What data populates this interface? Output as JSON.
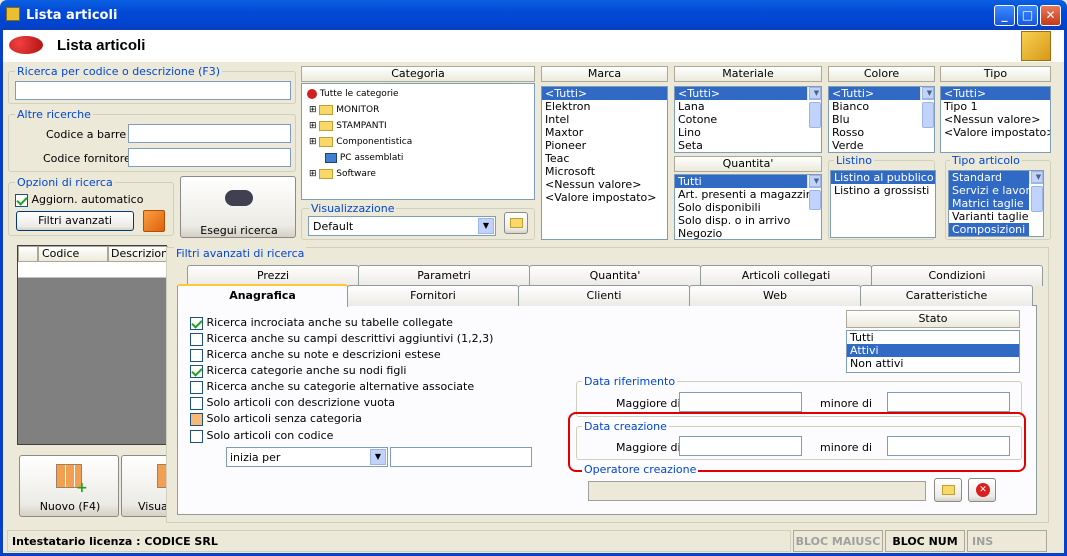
{
  "window": {
    "title": "Lista articoli",
    "header": "Lista articoli",
    "min": "_",
    "max": "□",
    "close": "✕"
  },
  "search": {
    "label": "Ricerca per codice o descrizione (F3)",
    "value": ""
  },
  "other": {
    "label": "Altre ricerche",
    "barcode_label": "Codice a barre :",
    "supplier_label": "Codice fornitore :"
  },
  "options": {
    "label": "Opzioni di ricerca",
    "auto_update": "Aggiorn. automatico",
    "advanced_button": "Filtri avanzati",
    "execute_button": "Esegui ricerca"
  },
  "categoria": {
    "header": "Categoria",
    "root": "Tutte le categorie",
    "items": [
      "MONITOR",
      "STAMPANTI",
      "Componentistica",
      "PC assemblati",
      "Software"
    ]
  },
  "visualizzazione": {
    "label": "Visualizzazione",
    "value": "Default"
  },
  "marca": {
    "header": "Marca",
    "items": [
      "<Tutti>",
      "Elektron",
      "Intel",
      "Maxtor",
      "Pioneer",
      "Teac",
      "Microsoft",
      "<Nessun valore>",
      "<Valore impostato>"
    ]
  },
  "materiale": {
    "header": "Materiale",
    "items": [
      "<Tutti>",
      "Lana",
      "Cotone",
      "Lino",
      "Seta"
    ]
  },
  "quantita": {
    "header": "Quantita'",
    "items": [
      "Tutti",
      "Art. presenti a magazzino",
      "Solo disponibili",
      "Solo disp. o in arrivo",
      "Negozio"
    ]
  },
  "colore": {
    "header": "Colore",
    "items": [
      "<Tutti>",
      "Bianco",
      "Blu",
      "Rosso",
      "Verde"
    ]
  },
  "listino": {
    "label": "Listino",
    "items": [
      "Listino al pubblico",
      "Listino a grossisti"
    ]
  },
  "tipo": {
    "header": "Tipo",
    "items": [
      "<Tutti>",
      "Tipo 1",
      "<Nessun valore>",
      "<Valore impostato>"
    ]
  },
  "tipo_articolo": {
    "label": "Tipo articolo",
    "items": [
      "Standard",
      "Servizi e lavorazioni",
      "Matrici taglie",
      "Varianti taglie",
      "Composizioni"
    ]
  },
  "grid": {
    "col1": "Codice",
    "col2": "Descrizione"
  },
  "bottom_buttons": {
    "nuovo": "Nuovo (F4)",
    "visual": "Visual"
  },
  "adv": {
    "label": "Filtri avanzati di ricerca",
    "tabs_top": [
      "Prezzi",
      "Parametri",
      "Quantita'",
      "Articoli collegati",
      "Condizioni"
    ],
    "tabs_bottom": [
      "Anagrafica",
      "Fornitori",
      "Clienti",
      "Web",
      "Caratteristiche"
    ],
    "checks": [
      "Ricerca incrociata anche su tabelle collegate",
      "Ricerca anche su campi descrittivi aggiuntivi (1,2,3)",
      "Ricerca anche su note e descrizioni estese",
      "Ricerca categorie anche su nodi figli",
      "Ricerca anche su categorie alternative associate",
      "Solo articoli con descrizione vuota",
      "Solo articoli senza categoria",
      "Solo articoli con codice"
    ],
    "combo": "inizia per",
    "stato_header": "Stato",
    "stato_items": [
      "Tutti",
      "Attivi",
      "Non attivi"
    ],
    "data_rif": "Data riferimento",
    "data_crea": "Data creazione",
    "maggiore": "Maggiore di",
    "minore": "minore di",
    "operatore": "Operatore creazione"
  },
  "status": {
    "license": "Intestatario licenza : CODICE SRL",
    "caps": "BLOC MAIUSC",
    "num": "BLOC NUM",
    "ins": "INS"
  },
  "colors": {
    "accent": "#316AC5",
    "highlight": "#E00000"
  }
}
